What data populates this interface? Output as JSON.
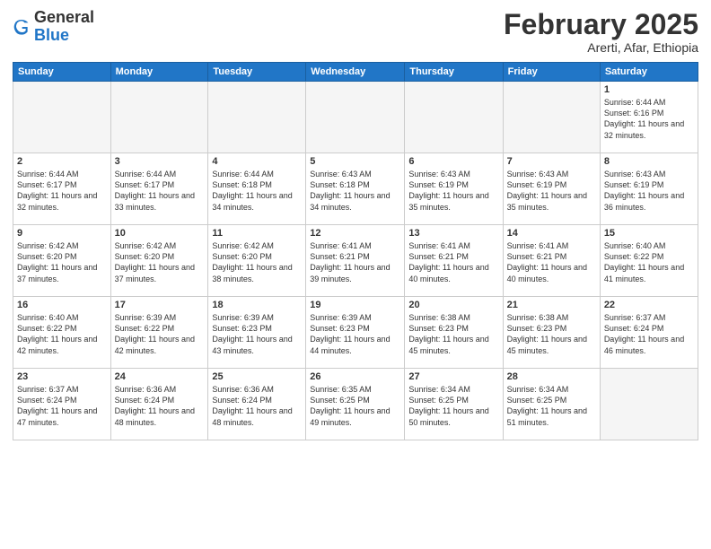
{
  "logo": {
    "general": "General",
    "blue": "Blue"
  },
  "title": "February 2025",
  "location": "Arerti, Afar, Ethiopia",
  "days_of_week": [
    "Sunday",
    "Monday",
    "Tuesday",
    "Wednesday",
    "Thursday",
    "Friday",
    "Saturday"
  ],
  "weeks": [
    [
      {
        "day": "",
        "info": ""
      },
      {
        "day": "",
        "info": ""
      },
      {
        "day": "",
        "info": ""
      },
      {
        "day": "",
        "info": ""
      },
      {
        "day": "",
        "info": ""
      },
      {
        "day": "",
        "info": ""
      },
      {
        "day": "1",
        "info": "Sunrise: 6:44 AM\nSunset: 6:16 PM\nDaylight: 11 hours and 32 minutes."
      }
    ],
    [
      {
        "day": "2",
        "info": "Sunrise: 6:44 AM\nSunset: 6:17 PM\nDaylight: 11 hours and 32 minutes."
      },
      {
        "day": "3",
        "info": "Sunrise: 6:44 AM\nSunset: 6:17 PM\nDaylight: 11 hours and 33 minutes."
      },
      {
        "day": "4",
        "info": "Sunrise: 6:44 AM\nSunset: 6:18 PM\nDaylight: 11 hours and 34 minutes."
      },
      {
        "day": "5",
        "info": "Sunrise: 6:43 AM\nSunset: 6:18 PM\nDaylight: 11 hours and 34 minutes."
      },
      {
        "day": "6",
        "info": "Sunrise: 6:43 AM\nSunset: 6:19 PM\nDaylight: 11 hours and 35 minutes."
      },
      {
        "day": "7",
        "info": "Sunrise: 6:43 AM\nSunset: 6:19 PM\nDaylight: 11 hours and 35 minutes."
      },
      {
        "day": "8",
        "info": "Sunrise: 6:43 AM\nSunset: 6:19 PM\nDaylight: 11 hours and 36 minutes."
      }
    ],
    [
      {
        "day": "9",
        "info": "Sunrise: 6:42 AM\nSunset: 6:20 PM\nDaylight: 11 hours and 37 minutes."
      },
      {
        "day": "10",
        "info": "Sunrise: 6:42 AM\nSunset: 6:20 PM\nDaylight: 11 hours and 37 minutes."
      },
      {
        "day": "11",
        "info": "Sunrise: 6:42 AM\nSunset: 6:20 PM\nDaylight: 11 hours and 38 minutes."
      },
      {
        "day": "12",
        "info": "Sunrise: 6:41 AM\nSunset: 6:21 PM\nDaylight: 11 hours and 39 minutes."
      },
      {
        "day": "13",
        "info": "Sunrise: 6:41 AM\nSunset: 6:21 PM\nDaylight: 11 hours and 40 minutes."
      },
      {
        "day": "14",
        "info": "Sunrise: 6:41 AM\nSunset: 6:21 PM\nDaylight: 11 hours and 40 minutes."
      },
      {
        "day": "15",
        "info": "Sunrise: 6:40 AM\nSunset: 6:22 PM\nDaylight: 11 hours and 41 minutes."
      }
    ],
    [
      {
        "day": "16",
        "info": "Sunrise: 6:40 AM\nSunset: 6:22 PM\nDaylight: 11 hours and 42 minutes."
      },
      {
        "day": "17",
        "info": "Sunrise: 6:39 AM\nSunset: 6:22 PM\nDaylight: 11 hours and 42 minutes."
      },
      {
        "day": "18",
        "info": "Sunrise: 6:39 AM\nSunset: 6:23 PM\nDaylight: 11 hours and 43 minutes."
      },
      {
        "day": "19",
        "info": "Sunrise: 6:39 AM\nSunset: 6:23 PM\nDaylight: 11 hours and 44 minutes."
      },
      {
        "day": "20",
        "info": "Sunrise: 6:38 AM\nSunset: 6:23 PM\nDaylight: 11 hours and 45 minutes."
      },
      {
        "day": "21",
        "info": "Sunrise: 6:38 AM\nSunset: 6:23 PM\nDaylight: 11 hours and 45 minutes."
      },
      {
        "day": "22",
        "info": "Sunrise: 6:37 AM\nSunset: 6:24 PM\nDaylight: 11 hours and 46 minutes."
      }
    ],
    [
      {
        "day": "23",
        "info": "Sunrise: 6:37 AM\nSunset: 6:24 PM\nDaylight: 11 hours and 47 minutes."
      },
      {
        "day": "24",
        "info": "Sunrise: 6:36 AM\nSunset: 6:24 PM\nDaylight: 11 hours and 48 minutes."
      },
      {
        "day": "25",
        "info": "Sunrise: 6:36 AM\nSunset: 6:24 PM\nDaylight: 11 hours and 48 minutes."
      },
      {
        "day": "26",
        "info": "Sunrise: 6:35 AM\nSunset: 6:25 PM\nDaylight: 11 hours and 49 minutes."
      },
      {
        "day": "27",
        "info": "Sunrise: 6:34 AM\nSunset: 6:25 PM\nDaylight: 11 hours and 50 minutes."
      },
      {
        "day": "28",
        "info": "Sunrise: 6:34 AM\nSunset: 6:25 PM\nDaylight: 11 hours and 51 minutes."
      },
      {
        "day": "",
        "info": ""
      }
    ]
  ]
}
